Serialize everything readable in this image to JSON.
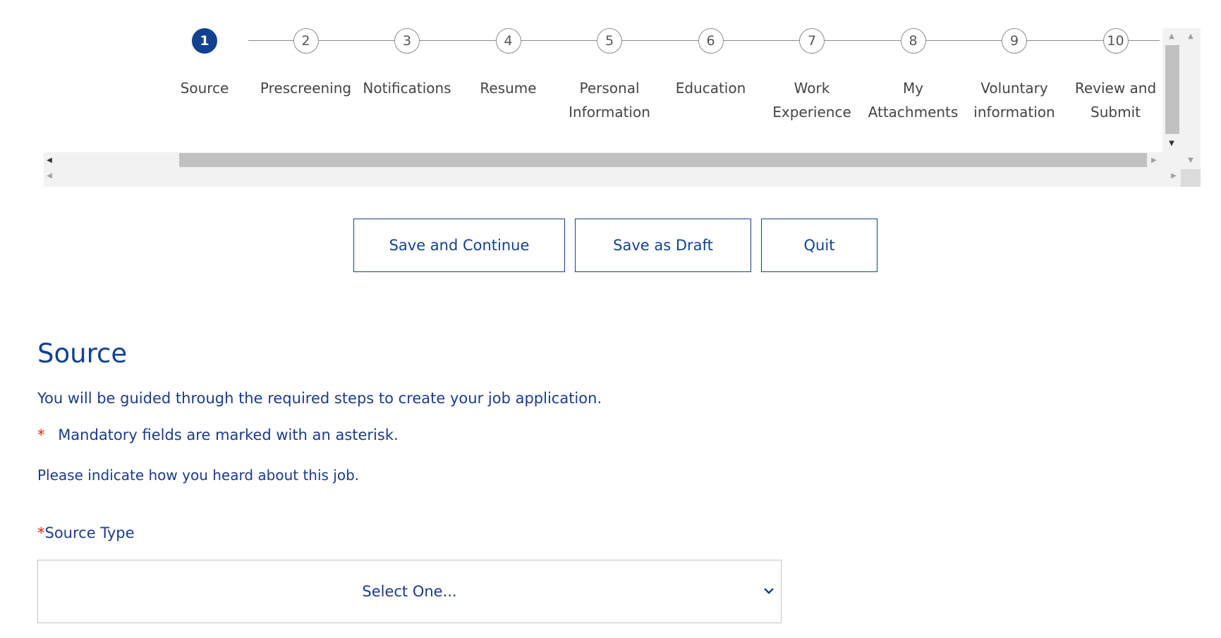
{
  "steps": [
    {
      "number": "1",
      "label": "Source",
      "active": true
    },
    {
      "number": "2",
      "label": "Prescreening"
    },
    {
      "number": "3",
      "label": "Notifications"
    },
    {
      "number": "4",
      "label": "Resume"
    },
    {
      "number": "5",
      "label": "Personal Information"
    },
    {
      "number": "6",
      "label": "Education"
    },
    {
      "number": "7",
      "label": "Work Experience"
    },
    {
      "number": "8",
      "label": "My Attachments"
    },
    {
      "number": "9",
      "label": "Voluntary information"
    },
    {
      "number": "10",
      "label": "Review and Submit"
    }
  ],
  "actions": {
    "save_continue_label": "Save and Continue",
    "save_draft_label": "Save as Draft",
    "quit_label": "Quit"
  },
  "form": {
    "title": "Source",
    "intro": "You will be guided through the required steps to create your job application.",
    "mandatory_marker": "*",
    "mandatory_text": "Mandatory fields are marked with an asterisk.",
    "hint": "Please indicate how you heard about this job.",
    "source_type_label": "Source Type",
    "source_type_value": "Select One..."
  },
  "icons": {
    "scroll_left": "triangle-left-icon",
    "scroll_right": "triangle-right-icon",
    "scroll_up": "triangle-up-icon",
    "scroll_down": "triangle-down-icon",
    "select": "chevron-down-icon"
  },
  "colors": {
    "primary": "#124191",
    "text": "#1b3b8a",
    "required": "#e2231a",
    "scroll_thumb": "#c1c1c1"
  }
}
